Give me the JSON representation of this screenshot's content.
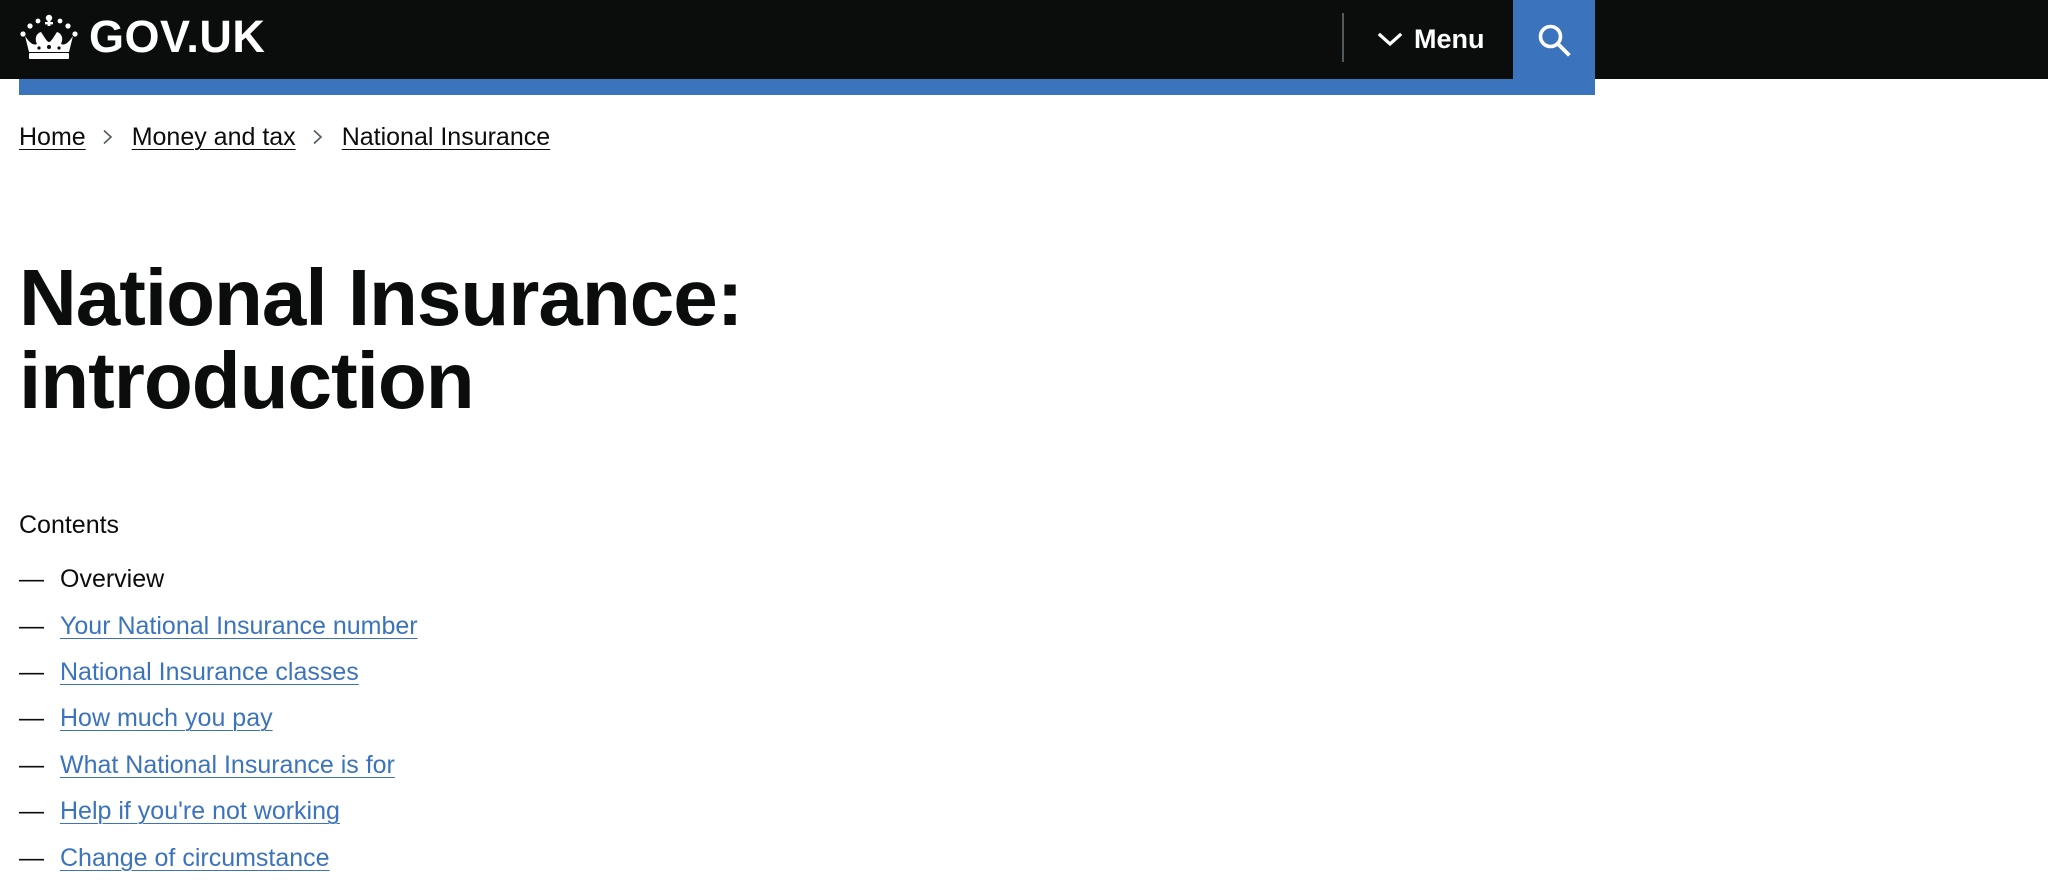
{
  "header": {
    "logo_text": "GOV.UK",
    "menu_label": "Menu",
    "colors": {
      "background": "#0b0c0c",
      "accent": "#3c73bd"
    }
  },
  "breadcrumbs": [
    {
      "label": "Home"
    },
    {
      "label": "Money and tax"
    },
    {
      "label": "National Insurance"
    }
  ],
  "page": {
    "title_line1": "National Insurance:",
    "title_line2": "introduction"
  },
  "contents": {
    "label": "Contents",
    "dash": "—",
    "items": [
      {
        "label": "Overview",
        "current": true
      },
      {
        "label": "Your National Insurance number"
      },
      {
        "label": "National Insurance classes"
      },
      {
        "label": "How much you pay"
      },
      {
        "label": "What National Insurance is for"
      },
      {
        "label": "Help if you're not working"
      },
      {
        "label": "Change of circumstance"
      }
    ]
  },
  "icons": {
    "logo": "crown-icon",
    "menu": "chevron-down-icon",
    "search": "search-icon",
    "breadcrumb_separator": "chevron-right-icon"
  }
}
